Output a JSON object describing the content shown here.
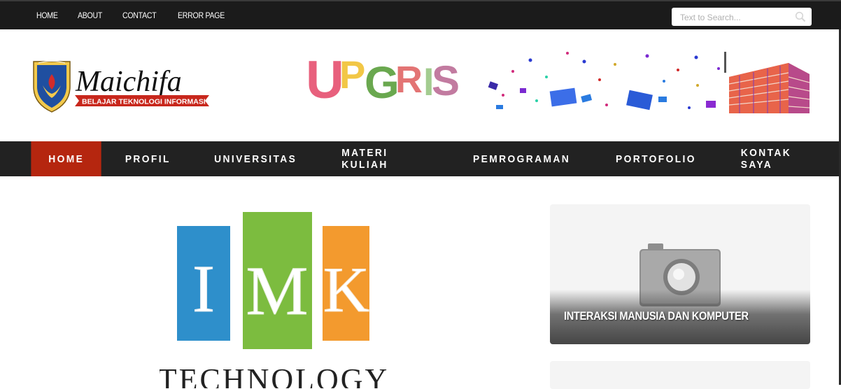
{
  "topbar": {
    "links": [
      "HOME",
      "ABOUT",
      "CONTACT",
      "ERROR PAGE"
    ],
    "search_placeholder": "Text to Search..."
  },
  "header": {
    "logo_title": "Maichifa",
    "logo_subtitle": "BELAJAR TEKNOLOGI INFORMASI",
    "banner_text": "UPGRIS"
  },
  "nav": {
    "items": [
      "HOME",
      "PROFIL",
      "UNIVERSITAS",
      "MATERI KULIAH",
      "PEMROGRAMAN",
      "PORTOFOLIO",
      "KONTAK SAYA"
    ],
    "active_index": 0
  },
  "post": {
    "image_letters": [
      "I",
      "M",
      "K"
    ],
    "image_word": "TECHNOLOGY"
  },
  "sidebar": {
    "card_title": "INTERAKSI MANUSIA DAN KOMPUTER"
  },
  "colors": {
    "topbar_bg": "#1b1b1b",
    "nav_bg": "#222222",
    "nav_active": "#b5260f"
  }
}
